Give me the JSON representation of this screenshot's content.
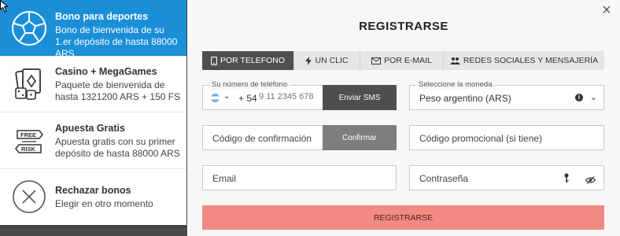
{
  "bonuses": [
    {
      "title": "Bono para deportes",
      "desc": "Bono de bienvenida de su 1.er depósito de hasta 88000 ARS",
      "icon": "soccer-ball-icon"
    },
    {
      "title": "Casino + MegaGames",
      "desc": "Paquete de bienvenida de hasta 1321200 ARS + 150 FS",
      "icon": "cards-dice-icon"
    },
    {
      "title": "Apuesta Gratis",
      "desc": "Apuesta gratis con su primer depósito de hasta 88000 ARS",
      "icon": "free-risk-icon"
    },
    {
      "title": "Rechazar bonos",
      "desc": "Elegir en otro momento",
      "icon": "reject-x-icon"
    }
  ],
  "modal": {
    "close_label": "×",
    "title": "REGISTRARSE",
    "tabs": [
      {
        "label": "POR TELEFONO",
        "icon": "phone-icon"
      },
      {
        "label": "UN CLIC",
        "icon": "lightning-icon"
      },
      {
        "label": "POR E-MAIL",
        "icon": "envelope-icon"
      },
      {
        "label": "REDES SOCIALES Y MENSAJERÍA",
        "icon": "people-icon"
      }
    ],
    "phone": {
      "label": "Su número de teléfono",
      "country_code": "+ 54",
      "placeholder": "9 11 2345 678",
      "send_sms": "Enviar SMS"
    },
    "currency": {
      "label": "Seleccione la moneda",
      "value": "Peso argentino (ARS)"
    },
    "confirmation": {
      "placeholder": "Código de confirmación",
      "button": "Confirmar"
    },
    "promo": {
      "placeholder": "Código promocional (si tiene)"
    },
    "email": {
      "placeholder": "Email"
    },
    "password": {
      "placeholder": "Contraseña"
    },
    "submit": "REGISTRARSE"
  },
  "colors": {
    "active_bonus": "#1a8fd8",
    "active_tab": "#4f4f4f",
    "submit": "#f08a82"
  }
}
